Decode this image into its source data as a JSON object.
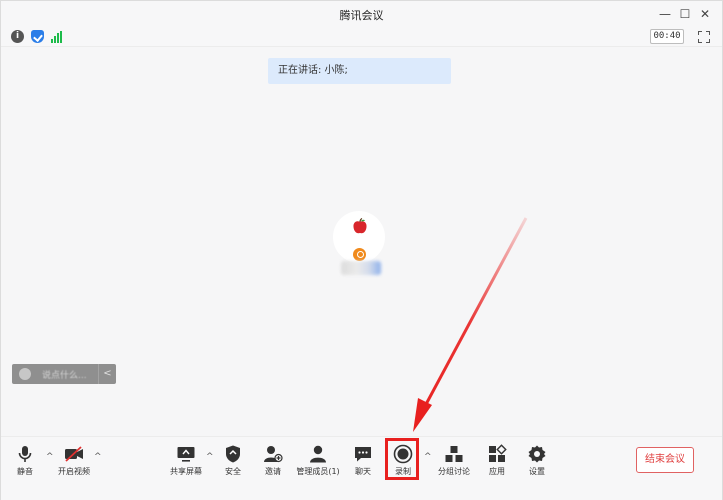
{
  "window": {
    "title": "腾讯会议"
  },
  "status": {
    "timer": "00:40"
  },
  "main": {
    "speaking": "正在讲话: 小陈;",
    "chat_placeholder": "说点什么...",
    "chat_collapse": "<"
  },
  "toolbar": {
    "mute": "静音",
    "video": "开启视频",
    "share": "共享屏幕",
    "security": "安全",
    "invite": "邀请",
    "members": "管理成员(1)",
    "chat": "聊天",
    "record": "录制",
    "breakout": "分组讨论",
    "apps": "应用",
    "settings": "设置",
    "end": "结束会议",
    "caret": "^"
  },
  "colors": {
    "accent_blue": "#2a7de8",
    "highlight_red": "#e8201f",
    "signal_green": "#1dbb4a",
    "speaking_bg": "#dceafc"
  }
}
